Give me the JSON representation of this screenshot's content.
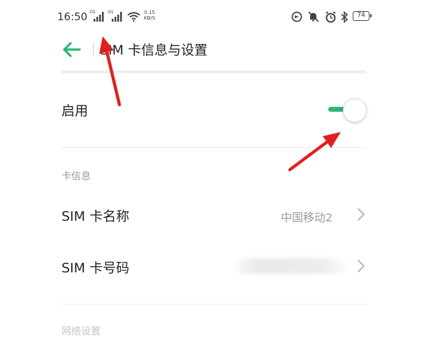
{
  "status_bar": {
    "time": "16:50",
    "sim1_tag": "2G",
    "sim2_tag": "2G",
    "net_speed_value": "0.15",
    "net_speed_unit": "KB/S",
    "battery_level": "74",
    "icons": [
      "signal-icon",
      "signal-icon",
      "wifi-icon",
      "data-saver-icon",
      "mute-icon",
      "alarm-icon",
      "bluetooth-icon",
      "battery-icon"
    ]
  },
  "toolbar": {
    "title": "SIM 卡信息与设置",
    "back_icon": "back-arrow-icon"
  },
  "enable_row": {
    "label": "启用",
    "toggle_on": true
  },
  "card_info": {
    "section_label": "卡信息",
    "name_row": {
      "label": "SIM 卡名称",
      "value": "中国移动2"
    },
    "number_row": {
      "label": "SIM 卡号码",
      "value": ""
    }
  },
  "network": {
    "section_label": "网络设置"
  },
  "colors": {
    "accent": "#2bb673",
    "annotation_arrow": "#e02020",
    "secondary_text": "#9a9a9a"
  }
}
